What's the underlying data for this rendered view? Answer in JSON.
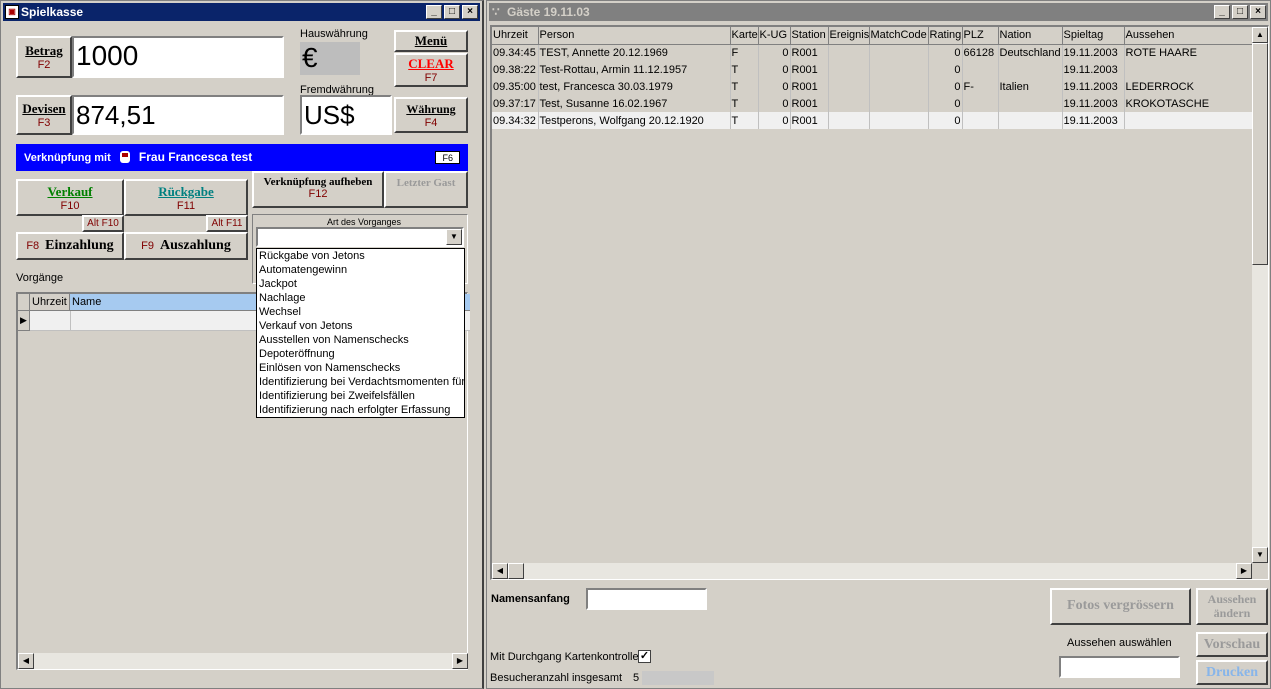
{
  "left_window": {
    "title": "Spielkasse",
    "betrag": {
      "label": "Betrag",
      "fkey": "F2",
      "value": "1000"
    },
    "devisen": {
      "label": "Devisen",
      "fkey": "F3",
      "value": "874,51"
    },
    "hauswaehrung": {
      "label": "Hauswährung",
      "value": "€"
    },
    "fremdwaehrung": {
      "label": "Fremdwährung",
      "value": "US$"
    },
    "menu_button": "Menü",
    "clear_button": {
      "label": "CLEAR",
      "fkey": "F7"
    },
    "waehrung_button": {
      "label": "Währung",
      "fkey": "F4"
    },
    "link_bar": {
      "prefix": "Verknüpfung mit",
      "name": "Frau Francesca test",
      "fkey": "F6"
    },
    "verkauf": {
      "label": "Verkauf",
      "fkey": "F10",
      "alt": "Alt F10"
    },
    "rueckgabe": {
      "label": "Rückgabe",
      "fkey": "F11",
      "alt": "Alt F11"
    },
    "verkn_aufheben": {
      "label": "Verknüpfung aufheben",
      "fkey": "F12"
    },
    "letzter_gast": "Letzter Gast",
    "einzahlung": {
      "fkey": "F8",
      "label": "Einzahlung"
    },
    "auszahlung": {
      "fkey": "F9",
      "label": "Auszahlung"
    },
    "art_label": "Art des Vorganges",
    "art_options": [
      "Rückgabe von Jetons",
      "Automatengewinn",
      "Jackpot",
      "Nachlage",
      "Wechsel",
      "Verkauf von Jetons",
      "Ausstellen von Namenschecks",
      "Depoteröffnung",
      "Einlösen von Namenschecks",
      "Identifizierung bei Verdachtsmomenten für",
      "Identifizierung bei Zweifelsfällen",
      "Identifizierung nach erfolgter Erfassung"
    ],
    "vorgaenge_label": "Vorgänge",
    "vorgaenge_columns": [
      "Uhrzeit",
      "Name"
    ]
  },
  "right_window": {
    "title": "Gäste 19.11.03",
    "columns": [
      "Uhrzeit",
      "Person",
      "Karte",
      "K-UG",
      "Station",
      "Ereignis",
      "MatchCode",
      "Rating",
      "PLZ",
      "Nation",
      "Spieltag",
      "Aussehen"
    ],
    "rows": [
      [
        "09.34:45",
        "TEST, Annette  20.12.1969",
        "F",
        "0",
        "R001",
        "",
        "",
        "0",
        "66128",
        "Deutschland",
        "19.11.2003",
        "ROTE HAARE"
      ],
      [
        "09.38:22",
        "Test-Rottau, Armin  11.12.1957",
        "T",
        "0",
        "R001",
        "",
        "",
        "0",
        "",
        "",
        "19.11.2003",
        ""
      ],
      [
        "09.35:00",
        "test, Francesca  30.03.1979",
        "T",
        "0",
        "R001",
        "",
        "",
        "0",
        "F-",
        "Italien",
        "19.11.2003",
        "LEDERROCK"
      ],
      [
        "09.37:17",
        "Test, Susanne  16.02.1967",
        "T",
        "0",
        "R001",
        "",
        "",
        "0",
        "",
        "",
        "19.11.2003",
        "KROKOTASCHE"
      ],
      [
        "09.34:32",
        "Testperons, Wolfgang  20.12.1920",
        "T",
        "0",
        "R001",
        "",
        "",
        "0",
        "",
        "",
        "19.11.2003",
        ""
      ]
    ],
    "namensanfang_label": "Namensanfang",
    "namensanfang_value": "",
    "fotos_button": "Fotos vergrössern",
    "aussehen_aendern_button": "Aussehen ändern",
    "aussehen_auswaehlen_label": "Aussehen auswählen",
    "aussehen_value": "",
    "vorschau_button": "Vorschau",
    "drucken_button": "Drucken",
    "kartenkontrolle_label": "Mit Durchgang Kartenkontrolle",
    "kartenkontrolle_checked": "✓",
    "besucher_label": "Besucheranzahl insgesamt",
    "besucher_value": "5"
  },
  "colors": {
    "title_active": "#0a246a",
    "link_bar": "#0000ff",
    "fkey": "#800000",
    "clear": "#ff0000",
    "verkauf": "#008000",
    "rueckgabe": "#008080"
  }
}
